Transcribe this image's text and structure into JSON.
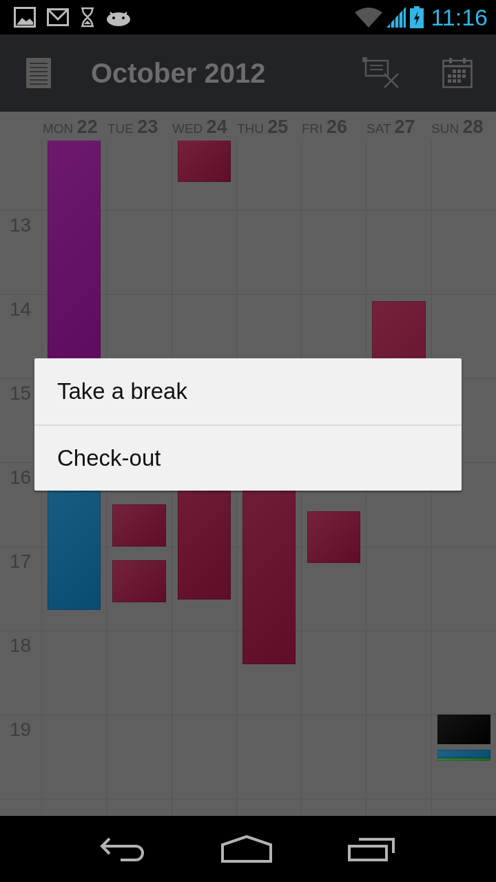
{
  "status_bar": {
    "time": "11:16"
  },
  "action_bar": {
    "title": "October 2012"
  },
  "days": [
    {
      "weekday": "MON",
      "date": "22",
      "events": [
        {
          "color": "#660a66"
        },
        {
          "color": "#0a557f"
        }
      ]
    },
    {
      "weekday": "TUE",
      "date": "23",
      "events": [
        {
          "color": "#6a0f2c"
        },
        {
          "color": "#6a0f2c"
        }
      ]
    },
    {
      "weekday": "WED",
      "date": "24",
      "events": [
        {
          "color": "#6a0f2c"
        },
        {
          "color": "#6a0f2c"
        }
      ]
    },
    {
      "weekday": "THU",
      "date": "25",
      "events": [
        {
          "color": "#6a0f2c"
        }
      ]
    },
    {
      "weekday": "FRI",
      "date": "26",
      "events": [
        {
          "color": "#6a0f2c"
        }
      ]
    },
    {
      "weekday": "SAT",
      "date": "27",
      "events": [
        {
          "color": "#6a0f2c"
        }
      ]
    },
    {
      "weekday": "SUN",
      "date": "28",
      "events": [
        {
          "color": "#000000"
        },
        {
          "color": "#0a557f"
        },
        {
          "color": "#1f7a2a"
        }
      ]
    }
  ],
  "hours": [
    "13",
    "14",
    "15",
    "16",
    "17",
    "18",
    "19"
  ],
  "dialog": {
    "items": [
      "Take a break",
      "Check-out"
    ]
  }
}
